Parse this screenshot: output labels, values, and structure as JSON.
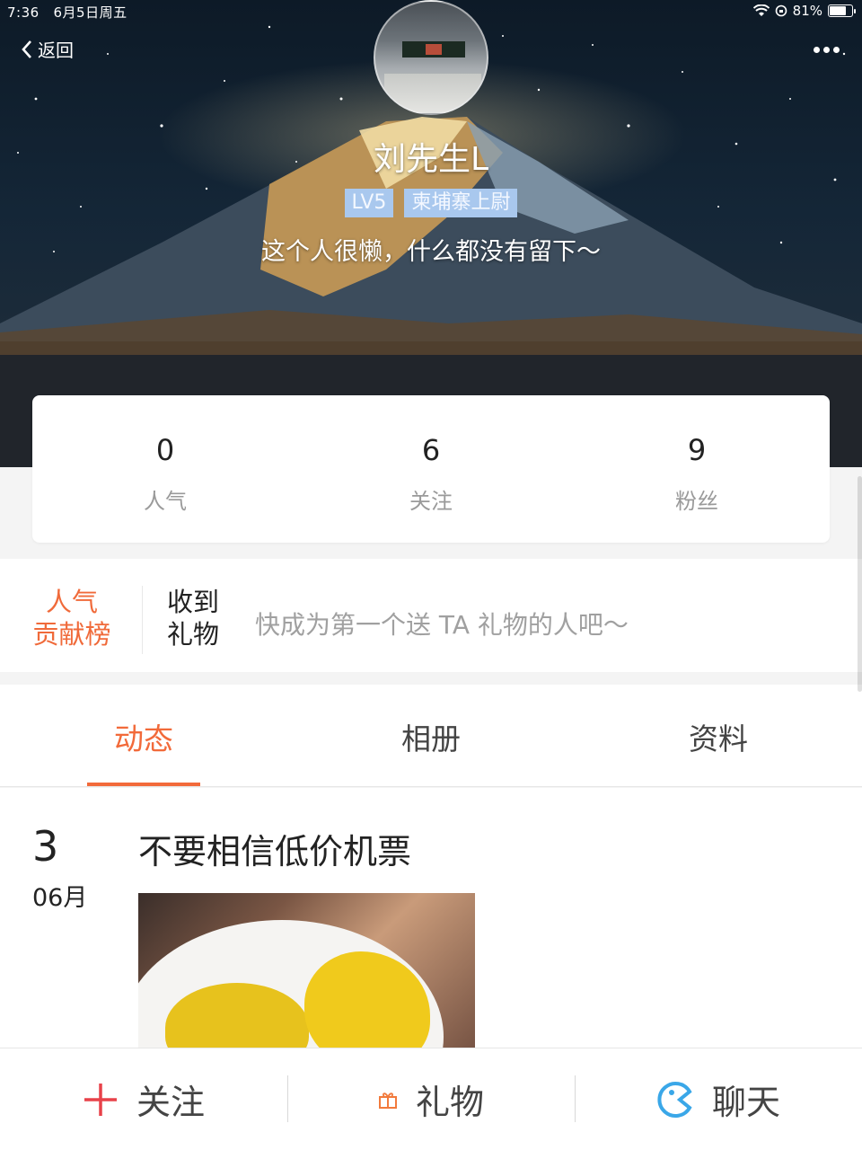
{
  "status_bar": {
    "time": "7:36",
    "date": "6月5日周五",
    "battery": "81%",
    "battery_level": 0.81
  },
  "nav": {
    "back_label": "返回",
    "more_icon": "ellipsis-icon"
  },
  "profile": {
    "nickname": "刘先生L",
    "level": "LV5",
    "rank_title": "柬埔寨上尉",
    "signature": "这个人很懒，什么都没有留下～"
  },
  "stats": [
    {
      "value": "0",
      "label": "人气"
    },
    {
      "value": "6",
      "label": "关注"
    },
    {
      "value": "9",
      "label": "粉丝"
    }
  ],
  "gifts": {
    "rank_line1": "人气",
    "rank_line2": "贡献榜",
    "received_line1": "收到",
    "received_line2": "礼物",
    "hint": "快成为第一个送 TA 礼物的人吧～"
  },
  "tabs": [
    {
      "label": "动态",
      "active": true
    },
    {
      "label": "相册",
      "active": false
    },
    {
      "label": "资料",
      "active": false
    }
  ],
  "post": {
    "day": "3",
    "month": "06月",
    "title": "不要相信低价机票"
  },
  "bottom_bar": {
    "follow": {
      "label": "关注",
      "icon": "plus-icon",
      "color": "#e8424a"
    },
    "gift": {
      "label": "礼物",
      "icon": "gift-icon",
      "color": "#f27a3c"
    },
    "chat": {
      "label": "聊天",
      "icon": "chat-bubble-icon",
      "color": "#3aa7e8"
    }
  },
  "colors": {
    "accent": "#f26a3a",
    "badge": "#a9c8ee"
  }
}
